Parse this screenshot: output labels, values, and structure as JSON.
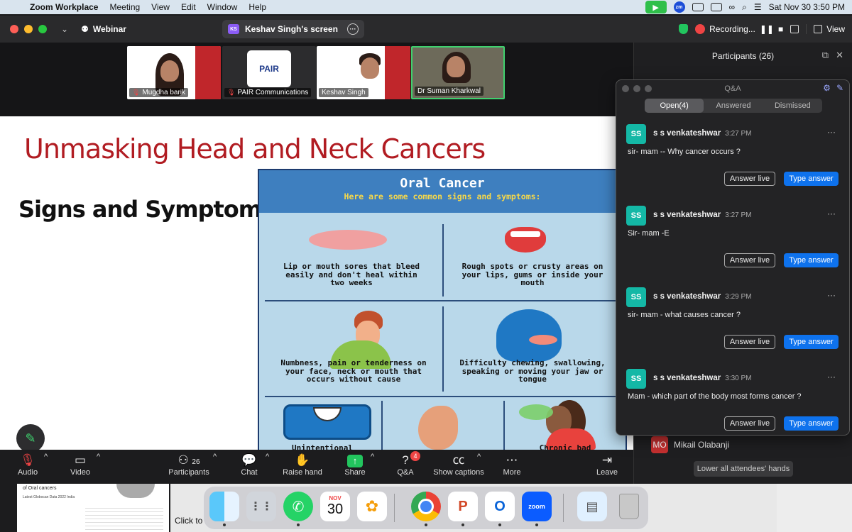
{
  "menubar": {
    "app_name": "Zoom Workplace",
    "menus": [
      "Meeting",
      "View",
      "Edit",
      "Window",
      "Help"
    ],
    "clock": "Sat Nov 30  3:50 PM",
    "zm_label": "zm"
  },
  "titlebar": {
    "webinar_label": "Webinar",
    "screen_badge": "KS",
    "screen_label": "Keshav Singh's screen",
    "recording_label": "Recording...",
    "view_label": "View"
  },
  "thumbnails": [
    {
      "name": "Mugdha barik",
      "muted": true
    },
    {
      "name": "PAIR Communications",
      "muted": true
    },
    {
      "name": "Keshav Singh",
      "muted": false
    },
    {
      "name": "Dr Suman Kharkwal",
      "muted": false
    }
  ],
  "pair_logo": {
    "text": "PAIR"
  },
  "slide": {
    "title": "Unmasking Head and Neck Cancers",
    "subtitle": "Signs and Symptoms",
    "infographic": {
      "title": "Oral Cancer",
      "subtitle": "Here are some common signs and symptoms:",
      "cells": [
        "Lip or mouth sores that bleed easily and don't heal within two weeks",
        "Rough spots or crusty areas on your lips, gums or inside your mouth",
        "Numbness, pain or tenderness on your face, neck or mouth that occurs without cause",
        "Difficulty chewing, swallowing, speaking or moving your jaw or tongue",
        "Unintentional",
        "Chronic bad"
      ]
    }
  },
  "toolbar": {
    "audio": "Audio",
    "video": "Video",
    "participants": "Participants",
    "participants_count": "26",
    "chat": "Chat",
    "raise_hand": "Raise hand",
    "share": "Share",
    "qa": "Q&A",
    "qa_badge": "4",
    "captions": "Show captions",
    "more": "More",
    "leave": "Leave"
  },
  "participants_panel": {
    "title": "Participants (26)",
    "visible_attendee": {
      "initials": "MO",
      "name": "Mikail Olabanji"
    },
    "lower_hands_label": "Lower all attendees' hands"
  },
  "qa": {
    "title": "Q&A",
    "tabs": [
      {
        "label": "Open(4)",
        "active": true
      },
      {
        "label": "Answered",
        "active": false
      },
      {
        "label": "Dismissed",
        "active": false
      }
    ],
    "answer_live_label": "Answer live",
    "type_answer_label": "Type answer",
    "questions": [
      {
        "initials": "SS",
        "author": "s s venkateshwar",
        "time": "3:27 PM",
        "text": "sir- mam -- Why cancer occurs ?"
      },
      {
        "initials": "SS",
        "author": "s s venkateshwar",
        "time": "3:27 PM",
        "text": "Sir- mam -E"
      },
      {
        "initials": "SS",
        "author": "s s venkateshwar",
        "time": "3:29 PM",
        "text": "sir- mam - what causes cancer ?"
      },
      {
        "initials": "SS",
        "author": "s s venkateshwar",
        "time": "3:30 PM",
        "text": "Mam - which part of the body most forms cancer ?"
      }
    ]
  },
  "background": {
    "doc_title": "of Oral cancers",
    "doc_line": "Latest Globocan Data 2022 India",
    "click_to": "Click to"
  },
  "dock": {
    "calendar_month": "NOV",
    "calendar_day": "30",
    "zoom_label": "zoom"
  },
  "colors": {
    "slide_title": "#b11c22",
    "accent_blue": "#0e72ed",
    "share_green": "#22c55e",
    "avatar_teal": "#14b8a6",
    "record_red": "#ef4444"
  }
}
